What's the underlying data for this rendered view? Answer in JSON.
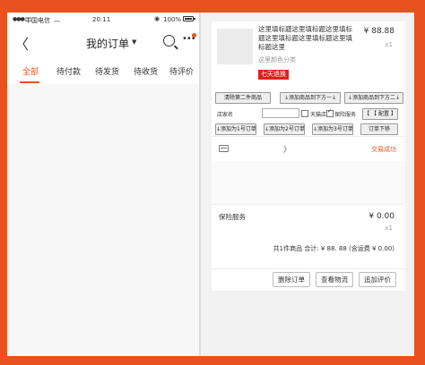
{
  "status_bar": {
    "signal": "●●●○○",
    "carrier": "中国电信",
    "wifi": "︵",
    "time": "20:11",
    "location_icon": "◉",
    "battery": "100%"
  },
  "navbar": {
    "back": "〈",
    "title": "我的订单",
    "title_caret": "▼",
    "more": "•••"
  },
  "tabs": [
    "全部",
    "待付款",
    "待发货",
    "待收货",
    "待评价"
  ],
  "product": {
    "title": "这里填标题这里填标题这里填标题这里填标题这里填标题这里填标题这里",
    "spec": "这里颜色分类",
    "price": "¥ 88.88",
    "qty": "x1",
    "badge": "七天退换"
  },
  "dev_controls": {
    "clear": "清除第二件商品",
    "add_below1": "↓添加商品到下方一↓",
    "add_below2": "↓添加商品到下方二↓",
    "brace": "【 【 配置 】",
    "shop_name_label": "店家名",
    "tmall_label": "天猫店",
    "insurance_label": "保险服务",
    "add_to1_btn": "添加 ↓",
    "add_order1": "↓添加为1号订单",
    "add_order2": "↓添加为2号订单",
    "add_order3": "↓添加为3号订单",
    "add_order4": "↓添加为4号订单",
    "order_below": "订单下移"
  },
  "shop": {
    "trade_status": "交易成功",
    "chevron": "〉"
  },
  "insurance": {
    "label": "保险服务",
    "price": "¥ 0.00",
    "qty": "x1"
  },
  "summary": "共1件商品 合计: ¥ 88. 88 (含运费 ¥ 0.00)",
  "actions": {
    "delete": "删除订单",
    "logistics": "查看物流",
    "review": "追加评价"
  },
  "colors": {
    "accent": "#e9511f",
    "badge": "#d9251d"
  }
}
